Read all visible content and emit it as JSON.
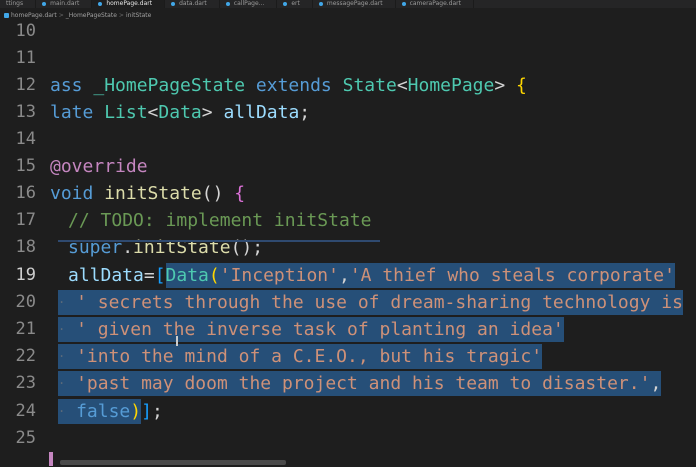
{
  "tabs": [
    {
      "label": "ttings",
      "active": false
    },
    {
      "label": "main.dart",
      "active": false
    },
    {
      "label": "homePage.dart",
      "active": true
    },
    {
      "label": "data.dart",
      "active": false
    },
    {
      "label": "callPage...",
      "active": false
    },
    {
      "label": "ert",
      "active": false
    },
    {
      "label": "messagePage.dart",
      "active": false
    },
    {
      "label": "cameraPage.dart",
      "active": false
    }
  ],
  "breadcrumb": {
    "file": "homePage.dart",
    "class": "_HomePageState",
    "method": "initState"
  },
  "gutter": [
    "10",
    "11",
    "12",
    "13",
    "14",
    "15",
    "16",
    "17",
    "18",
    "19",
    "20",
    "21",
    "22",
    "23",
    "24",
    "25"
  ],
  "current_line": "19",
  "code": {
    "l12": {
      "a": "ass ",
      "b": "_HomePageState",
      "c": " extends ",
      "d": "State",
      "e": "<",
      "f": "HomePage",
      "g": "> ",
      "h": "{"
    },
    "l13": {
      "a": "late ",
      "b": "List",
      "c": "<",
      "d": "Data",
      "e": "> ",
      "f": "allData",
      "g": ";"
    },
    "l15": {
      "a": "@",
      "b": "override"
    },
    "l16": {
      "a": "void ",
      "b": "initState",
      "c": "() ",
      "d": "{"
    },
    "l17": {
      "a": "// ",
      "b": "TODO",
      "c": ": implement initState"
    },
    "l18": {
      "a": "super",
      "b": ".",
      "c": "initState",
      "d": "();"
    },
    "l19": {
      "a": "allData",
      "b": "=",
      "c": "[",
      "d": "Data",
      "e": "(",
      "f": "'Inception'",
      "g": ",",
      "h": "'A thief who steals corporate'"
    },
    "l20": {
      "a": "' secrets through the use of dream-sharing technology is"
    },
    "l21": {
      "a": "' given the inverse task of planting an idea'"
    },
    "l22": {
      "a": "'into the mind of a C.E.O., but his tragic'"
    },
    "l23": {
      "a": "'past may doom the project and his team to disaster.'",
      "b": ","
    },
    "l24": {
      "a": "false",
      "b": ")",
      "c": "]",
      "d": ";"
    }
  },
  "colors": {
    "background": "#1e1e1e",
    "selection": "#264f78",
    "keyword": "#569cd6",
    "type": "#4ec9b0",
    "function": "#dcdcaa",
    "string": "#ce9178",
    "comment": "#6a9955"
  }
}
